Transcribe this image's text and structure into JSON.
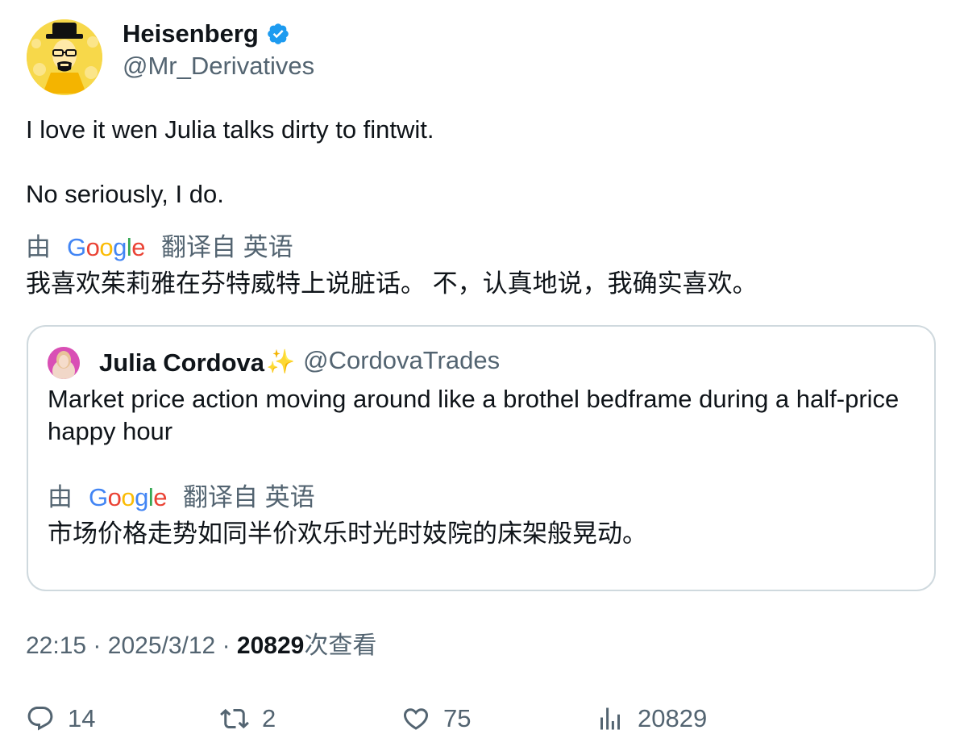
{
  "author": {
    "name": "Heisenberg",
    "handle": "@Mr_Derivatives",
    "verified_icon": "verified-badge-icon"
  },
  "tweet": {
    "line1": "I love it wen Julia talks dirty to fintwit.",
    "line2": "No seriously, I do."
  },
  "translation": {
    "by": "由",
    "google": "Google",
    "translated_from": "翻译自 英语",
    "text": "我喜欢茱莉雅在芬特威特上说脏话。 不，认真地说，我确实喜欢。"
  },
  "quote": {
    "name": "Julia Cordova",
    "sparkle": "✨",
    "handle": "@CordovaTrades",
    "text": "Market price action moving around like a brothel bedframe during a half-price happy hour",
    "translation": {
      "by": "由",
      "google": "Google",
      "translated_from": "翻译自 英语",
      "text": "市场价格走势如同半价欢乐时光时妓院的床架般晃动。"
    }
  },
  "meta": {
    "time": "22:15",
    "separator": "·",
    "date": "2025/3/12",
    "views_count": "20829",
    "views_label": "次查看"
  },
  "actions": {
    "replies": "14",
    "retweets": "2",
    "likes": "75",
    "views": "20829"
  },
  "colors": {
    "text": "#0f1419",
    "secondary": "#536471",
    "border": "#cfd9de",
    "verified": "#1d9bf0",
    "google_blue": "#4285f4",
    "google_red": "#ea4335",
    "google_yellow": "#fbbc05",
    "google_green": "#34a853"
  }
}
